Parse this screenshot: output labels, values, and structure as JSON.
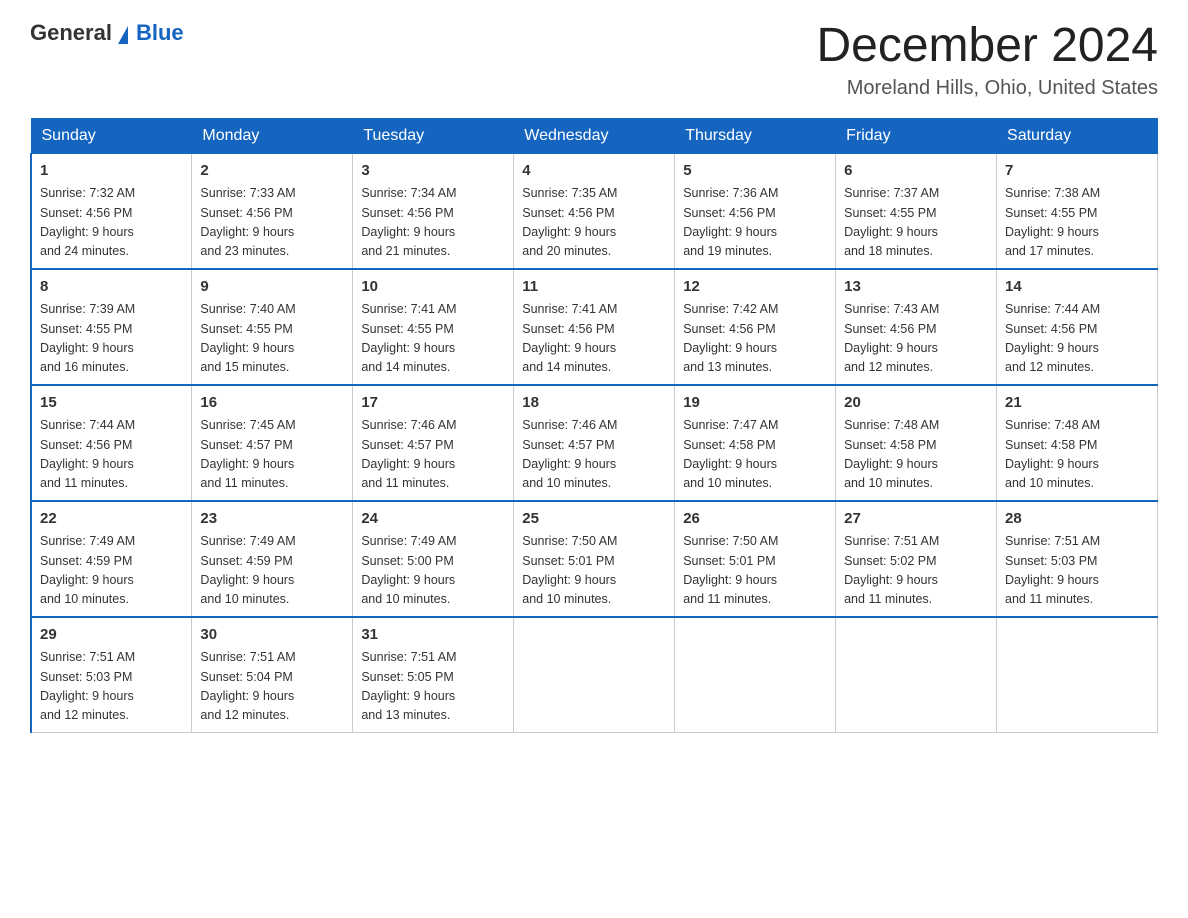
{
  "logo": {
    "text_general": "General",
    "text_blue": "Blue"
  },
  "title": "December 2024",
  "subtitle": "Moreland Hills, Ohio, United States",
  "days_of_week": [
    "Sunday",
    "Monday",
    "Tuesday",
    "Wednesday",
    "Thursday",
    "Friday",
    "Saturday"
  ],
  "weeks": [
    [
      {
        "day": "1",
        "sunrise": "7:32 AM",
        "sunset": "4:56 PM",
        "daylight": "9 hours and 24 minutes."
      },
      {
        "day": "2",
        "sunrise": "7:33 AM",
        "sunset": "4:56 PM",
        "daylight": "9 hours and 23 minutes."
      },
      {
        "day": "3",
        "sunrise": "7:34 AM",
        "sunset": "4:56 PM",
        "daylight": "9 hours and 21 minutes."
      },
      {
        "day": "4",
        "sunrise": "7:35 AM",
        "sunset": "4:56 PM",
        "daylight": "9 hours and 20 minutes."
      },
      {
        "day": "5",
        "sunrise": "7:36 AM",
        "sunset": "4:56 PM",
        "daylight": "9 hours and 19 minutes."
      },
      {
        "day": "6",
        "sunrise": "7:37 AM",
        "sunset": "4:55 PM",
        "daylight": "9 hours and 18 minutes."
      },
      {
        "day": "7",
        "sunrise": "7:38 AM",
        "sunset": "4:55 PM",
        "daylight": "9 hours and 17 minutes."
      }
    ],
    [
      {
        "day": "8",
        "sunrise": "7:39 AM",
        "sunset": "4:55 PM",
        "daylight": "9 hours and 16 minutes."
      },
      {
        "day": "9",
        "sunrise": "7:40 AM",
        "sunset": "4:55 PM",
        "daylight": "9 hours and 15 minutes."
      },
      {
        "day": "10",
        "sunrise": "7:41 AM",
        "sunset": "4:55 PM",
        "daylight": "9 hours and 14 minutes."
      },
      {
        "day": "11",
        "sunrise": "7:41 AM",
        "sunset": "4:56 PM",
        "daylight": "9 hours and 14 minutes."
      },
      {
        "day": "12",
        "sunrise": "7:42 AM",
        "sunset": "4:56 PM",
        "daylight": "9 hours and 13 minutes."
      },
      {
        "day": "13",
        "sunrise": "7:43 AM",
        "sunset": "4:56 PM",
        "daylight": "9 hours and 12 minutes."
      },
      {
        "day": "14",
        "sunrise": "7:44 AM",
        "sunset": "4:56 PM",
        "daylight": "9 hours and 12 minutes."
      }
    ],
    [
      {
        "day": "15",
        "sunrise": "7:44 AM",
        "sunset": "4:56 PM",
        "daylight": "9 hours and 11 minutes."
      },
      {
        "day": "16",
        "sunrise": "7:45 AM",
        "sunset": "4:57 PM",
        "daylight": "9 hours and 11 minutes."
      },
      {
        "day": "17",
        "sunrise": "7:46 AM",
        "sunset": "4:57 PM",
        "daylight": "9 hours and 11 minutes."
      },
      {
        "day": "18",
        "sunrise": "7:46 AM",
        "sunset": "4:57 PM",
        "daylight": "9 hours and 10 minutes."
      },
      {
        "day": "19",
        "sunrise": "7:47 AM",
        "sunset": "4:58 PM",
        "daylight": "9 hours and 10 minutes."
      },
      {
        "day": "20",
        "sunrise": "7:48 AM",
        "sunset": "4:58 PM",
        "daylight": "9 hours and 10 minutes."
      },
      {
        "day": "21",
        "sunrise": "7:48 AM",
        "sunset": "4:58 PM",
        "daylight": "9 hours and 10 minutes."
      }
    ],
    [
      {
        "day": "22",
        "sunrise": "7:49 AM",
        "sunset": "4:59 PM",
        "daylight": "9 hours and 10 minutes."
      },
      {
        "day": "23",
        "sunrise": "7:49 AM",
        "sunset": "4:59 PM",
        "daylight": "9 hours and 10 minutes."
      },
      {
        "day": "24",
        "sunrise": "7:49 AM",
        "sunset": "5:00 PM",
        "daylight": "9 hours and 10 minutes."
      },
      {
        "day": "25",
        "sunrise": "7:50 AM",
        "sunset": "5:01 PM",
        "daylight": "9 hours and 10 minutes."
      },
      {
        "day": "26",
        "sunrise": "7:50 AM",
        "sunset": "5:01 PM",
        "daylight": "9 hours and 11 minutes."
      },
      {
        "day": "27",
        "sunrise": "7:51 AM",
        "sunset": "5:02 PM",
        "daylight": "9 hours and 11 minutes."
      },
      {
        "day": "28",
        "sunrise": "7:51 AM",
        "sunset": "5:03 PM",
        "daylight": "9 hours and 11 minutes."
      }
    ],
    [
      {
        "day": "29",
        "sunrise": "7:51 AM",
        "sunset": "5:03 PM",
        "daylight": "9 hours and 12 minutes."
      },
      {
        "day": "30",
        "sunrise": "7:51 AM",
        "sunset": "5:04 PM",
        "daylight": "9 hours and 12 minutes."
      },
      {
        "day": "31",
        "sunrise": "7:51 AM",
        "sunset": "5:05 PM",
        "daylight": "9 hours and 13 minutes."
      },
      null,
      null,
      null,
      null
    ]
  ],
  "labels": {
    "sunrise": "Sunrise:",
    "sunset": "Sunset:",
    "daylight": "Daylight:"
  }
}
